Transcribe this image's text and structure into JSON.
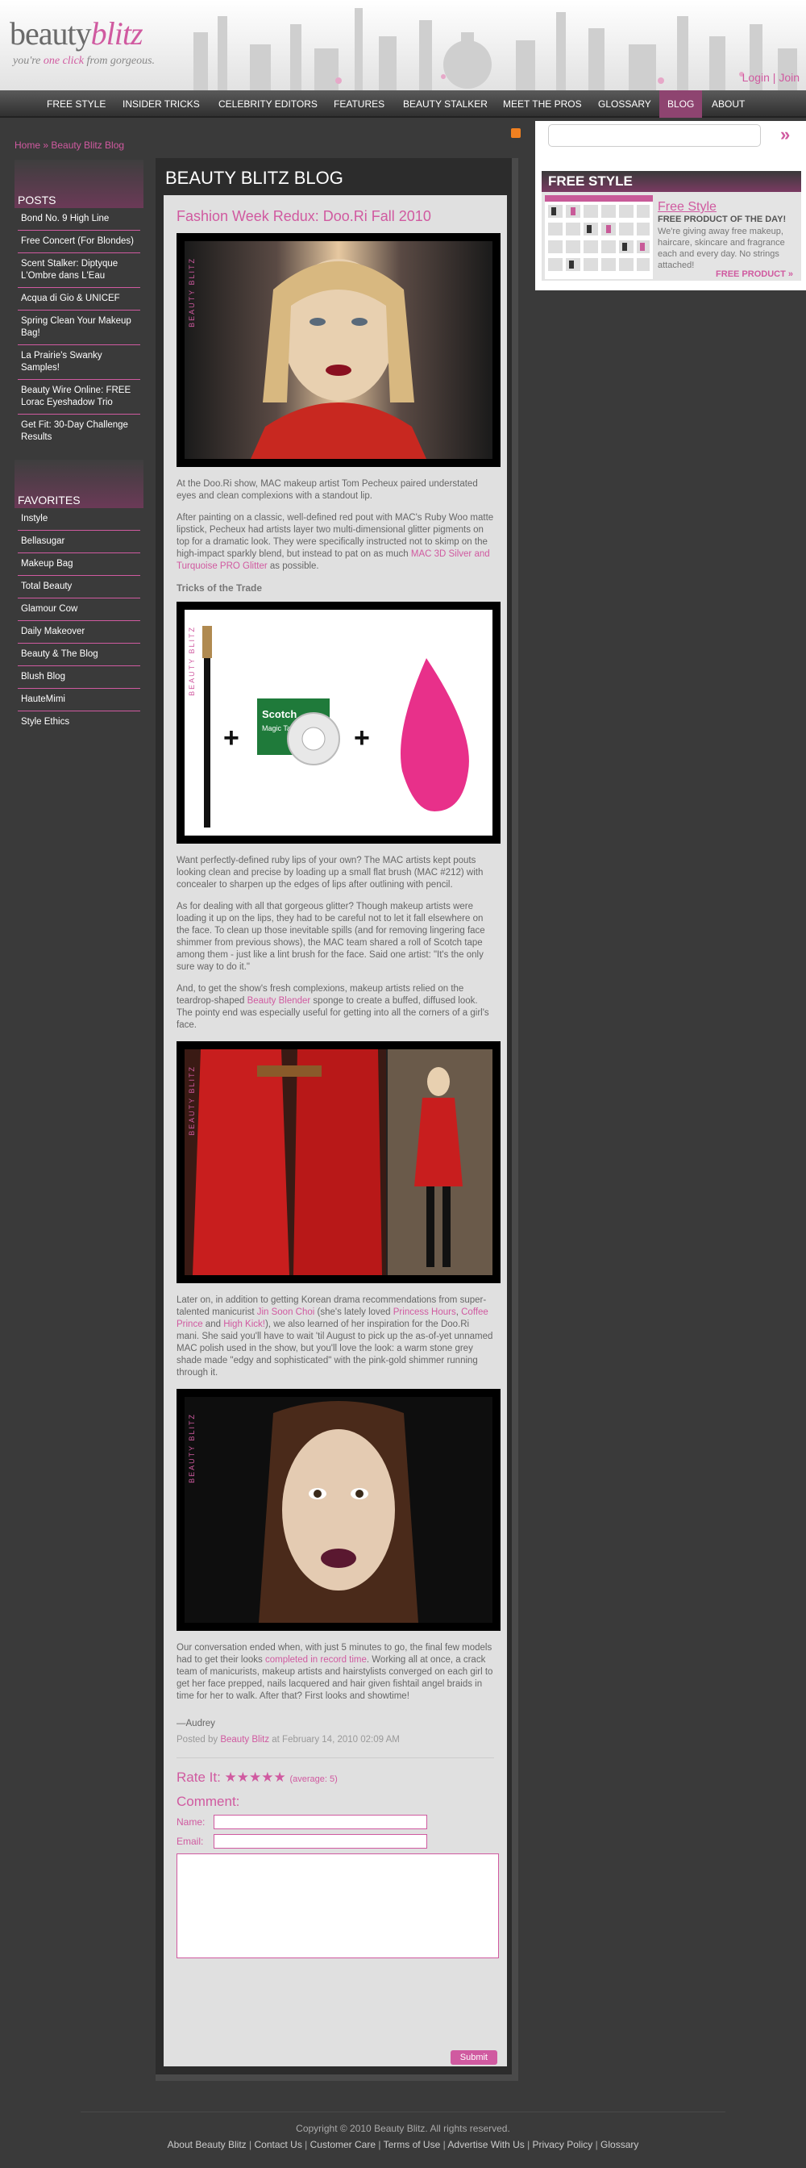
{
  "site": {
    "logo_part1": "beauty",
    "logo_part2": "blitz",
    "tagline_pre": "you're ",
    "tagline_hl": "one click",
    "tagline_post": " from gorgeous.",
    "login": "Login",
    "join": "Join"
  },
  "nav": [
    "FREE STYLE",
    "INSIDER TRICKS",
    "CELEBRITY EDITORS",
    "FEATURES",
    "BEAUTY STALKER",
    "MEET THE PROS",
    "GLOSSARY",
    "BLOG",
    "ABOUT"
  ],
  "nav_active": "BLOG",
  "breadcrumb": {
    "home": "Home",
    "sep": " » ",
    "current": "Beauty Blitz Blog"
  },
  "sidebar": {
    "posts_title": "POSTS",
    "posts": [
      "Bond No. 9 High Line",
      "Free Concert (For Blondes)",
      "Scent Stalker: Diptyque L'Ombre dans L'Eau",
      "Acqua di Gio & UNICEF",
      "Spring Clean Your Makeup Bag!",
      "La Prairie's Swanky Samples!",
      "Beauty Wire Online: FREE Lorac Eyeshadow Trio",
      "Get Fit: 30-Day Challenge Results"
    ],
    "favorites_title": "FAVORITES",
    "favorites": [
      "Instyle",
      "Bellasugar",
      "Makeup Bag",
      "Total Beauty",
      "Glamour Cow",
      "Daily Makeover",
      "Beauty & The Blog",
      "Blush Blog",
      "HauteMimi",
      "Style Ethics"
    ]
  },
  "main": {
    "title": "BEAUTY BLITZ BLOG",
    "post_title": "Fashion Week Redux: Doo.Ri Fall 2010",
    "watermark": "BEAUTY BLITZ",
    "p1": "At the Doo.Ri show, MAC makeup artist Tom Pecheux paired understated eyes and clean complexions with a standout lip.",
    "p2_pre": "After painting on a classic, well-defined red pout with MAC's Ruby Woo matte lipstick, Pecheux had artists layer two multi-dimensional glitter pigments on top for a dramatic look. They were specifically instructed not to skimp on the high-impact sparkly blend, but instead to pat on as much ",
    "p2_link": "MAC 3D Silver and Turquoise PRO Glitter",
    "p2_post": " as possible.",
    "subhead": "Tricks of the Trade",
    "p3": "Want perfectly-defined ruby lips of your own? The MAC artists kept pouts looking clean and precise by loading up a small flat brush (MAC #212) with concealer to sharpen up the edges of lips after outlining with pencil.",
    "p4": "As for dealing with all that gorgeous glitter? Though makeup artists were loading it up on the lips, they had to be careful not to let it fall elsewhere on the face. To clean up those inevitable spills (and for removing lingering face shimmer from previous shows), the MAC team shared a roll of Scotch tape among them - just like a lint brush for the face. Said one artist: \"It's the only sure way to do it.\"",
    "p5_pre": "And, to get the show's fresh complexions, makeup artists relied on the teardrop-shaped ",
    "p5_link": "Beauty Blender",
    "p5_post": " sponge to create a buffed, diffused look. The pointy end was especially useful for getting into all the corners of a girl's face.",
    "p6_a": "Later on, in addition to getting Korean drama recommendations from super-talented manicurist ",
    "p6_link1": "Jin Soon Choi",
    "p6_b": " (she's lately loved ",
    "p6_link2": "Princess Hours",
    "p6_c": ", ",
    "p6_link3": "Coffee Prince",
    "p6_d": " and ",
    "p6_link4": "High Kick!",
    "p6_e": "), we also learned of her inspiration for the Doo.Ri mani. She said you'll have to wait 'til August to pick up the as-of-yet unnamed MAC polish used in the show, but you'll love the look: a warm stone grey shade made \"edgy and sophisticated\" with the pink-gold shimmer running through it.",
    "p7_pre": "Our conversation ended when, with just 5 minutes to go, the final few models had to get their looks ",
    "p7_link": "completed in record time",
    "p7_post": ". Working all at once, a crack team of manicurists, makeup artists and hairstylists converged on each girl to get her face prepped, nails lacquered and hair given fishtail angel braids in time for her to walk. After that? First looks and showtime!",
    "signoff": "—Audrey",
    "posted_pre": "Posted by ",
    "posted_author": "Beauty Blitz",
    "posted_post": " at February 14, 2010 02:09 AM",
    "rate_label": "Rate It:",
    "rating": 5,
    "rate_stars": "★★★★★",
    "rate_avg": "(average: 5)",
    "comment_label": "Comment:",
    "name_label": "Name:",
    "email_label": "Email:",
    "submit": "Submit",
    "tape_brand": "Scotch",
    "tape_text": "Magic Tape"
  },
  "right": {
    "search_placeholder": "",
    "search_go": "»",
    "free_style_head": "FREE STYLE",
    "fs_title": "Free Style",
    "fs_sub": "FREE PRODUCT OF THE DAY!",
    "fs_desc": "We're giving away free makeup, haircare, skincare and fragrance each and every day. No strings attached!",
    "fs_more": "FREE PRODUCT »"
  },
  "footer": {
    "copyright": "Copyright © 2010 Beauty Blitz. All rights reserved.",
    "links": [
      "About Beauty Blitz",
      "Contact Us",
      "Customer Care",
      "Terms of Use",
      "Advertise With Us",
      "Privacy Policy",
      "Glossary"
    ]
  },
  "colors": {
    "accent": "#d05aa0",
    "nav_active": "#8e4470",
    "background": "#3a3a3a"
  }
}
